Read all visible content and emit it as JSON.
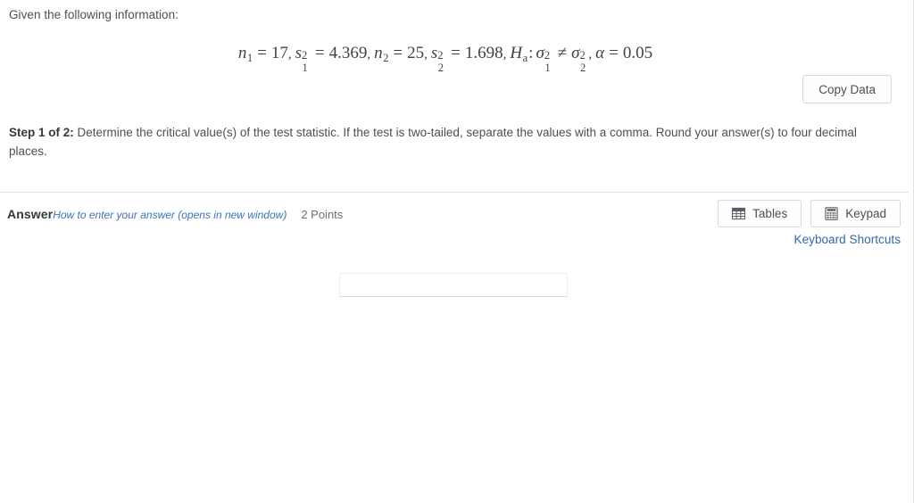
{
  "question": {
    "intro": "Given the following information:",
    "formula": {
      "n1_label": "n",
      "n1_sub": "1",
      "n1_value": "17",
      "s1_label": "s",
      "s1_sub": "1",
      "s1_sup": "2",
      "s1_value": "4.369",
      "n2_label": "n",
      "n2_sub": "2",
      "n2_value": "25",
      "s2_label": "s",
      "s2_sub": "2",
      "s2_sup": "2",
      "s2_value": "1.698",
      "hypothesis_label": "H",
      "hypothesis_sub": "a",
      "sigma1": "σ",
      "sigma1_sub": "1",
      "sigma1_sup": "2",
      "not_equal": "≠",
      "sigma2": "σ",
      "sigma2_sub": "2",
      "sigma2_sup": "2",
      "alpha_label": "α",
      "alpha_value": "0.05",
      "plain_text": "n₁ = 17, s₁² = 4.369, n₂ = 25, s₂² = 1.698, Hₐ: σ₁² ≠ σ₂², α = 0.05"
    },
    "copy_data_label": "Copy Data",
    "step_label": "Step 1 of 2:",
    "step_text": " Determine the critical value(s) of the test statistic. If the test is two-tailed, separate the values with a comma. Round your answer(s) to four decimal places."
  },
  "answer_bar": {
    "answer_label": "Answer",
    "help_link_label": "How to enter your answer (opens in new window)",
    "points_label": "2 Points",
    "tables_button_label": "Tables",
    "keypad_button_label": "Keypad",
    "keyboard_shortcuts_label": "Keyboard Shortcuts"
  },
  "answer_input": {
    "value": "",
    "placeholder": ""
  },
  "colors": {
    "link_blue": "#2f6aa8",
    "help_link_blue": "#3d73b5",
    "text": "#4a5055",
    "heading": "#33383d",
    "muted": "#6a7075",
    "border": "#d5dade",
    "divider": "#dfe3e6"
  },
  "icons": {
    "tables": "table-grid-icon",
    "keypad": "calculator-icon"
  }
}
